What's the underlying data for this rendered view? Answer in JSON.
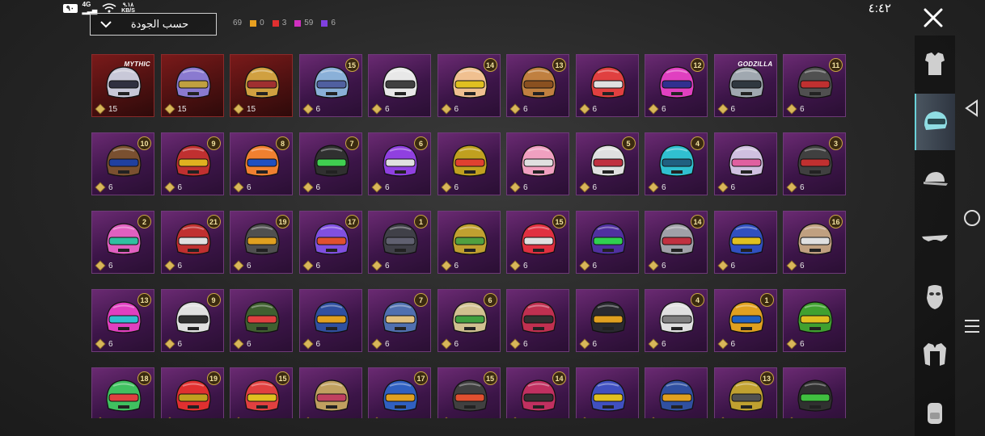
{
  "status": {
    "battery": "٩٠",
    "signal": "4G",
    "speed_value": "٩.١٨",
    "speed_unit": "KB/S",
    "clock": "٤:٤٢"
  },
  "sort": {
    "label": "حسب الجودة"
  },
  "counters": {
    "total": "69",
    "items": [
      {
        "name": "orange",
        "color": "#e8a020",
        "value": "0"
      },
      {
        "name": "red",
        "color": "#e03030",
        "value": "3"
      },
      {
        "name": "pink",
        "color": "#d030c0",
        "value": "59"
      },
      {
        "name": "purple",
        "color": "#8040e0",
        "value": "6"
      }
    ]
  },
  "grid": {
    "rows": [
      [
        {
          "badge": "",
          "tag": "MYTHIC",
          "count": "15",
          "tier": "red",
          "helmet": "#c8c8d8",
          "visor": "#303040"
        },
        {
          "badge": "",
          "tag": "",
          "count": "15",
          "tier": "red",
          "helmet": "#8a7ad0",
          "visor": "#c0a040"
        },
        {
          "badge": "",
          "tag": "",
          "count": "15",
          "tier": "red",
          "helmet": "#d0a040",
          "visor": "#a03030"
        },
        {
          "badge": "15",
          "tag": "",
          "count": "6",
          "tier": "purple",
          "helmet": "#8ab0d8",
          "visor": "#5060a0"
        },
        {
          "badge": "",
          "tag": "",
          "count": "6",
          "tier": "purple",
          "helmet": "#e8e8e8",
          "visor": "#404040"
        },
        {
          "badge": "14",
          "tag": "",
          "count": "6",
          "tier": "purple",
          "helmet": "#f0c090",
          "visor": "#e0c020"
        },
        {
          "badge": "13",
          "tag": "",
          "count": "6",
          "tier": "purple",
          "helmet": "#c08040",
          "visor": "#8a5020"
        },
        {
          "badge": "",
          "tag": "",
          "count": "6",
          "tier": "purple",
          "helmet": "#e04040",
          "visor": "#e0e0e0"
        },
        {
          "badge": "12",
          "tag": "",
          "count": "6",
          "tier": "purple",
          "helmet": "#e040c0",
          "visor": "#303090"
        },
        {
          "badge": "",
          "tag": "GODZILLA",
          "count": "6",
          "tier": "purple",
          "helmet": "#a0a8b0",
          "visor": "#303840"
        },
        {
          "badge": "11",
          "tag": "",
          "count": "6",
          "tier": "purple",
          "helmet": "#505050",
          "visor": "#c03030"
        }
      ],
      [
        {
          "badge": "10",
          "tag": "",
          "count": "6",
          "tier": "purple",
          "helmet": "#7a5030",
          "visor": "#2040a0"
        },
        {
          "badge": "9",
          "tag": "",
          "count": "6",
          "tier": "purple",
          "helmet": "#c03030",
          "visor": "#e0b020"
        },
        {
          "badge": "8",
          "tag": "",
          "count": "6",
          "tier": "purple",
          "helmet": "#f08030",
          "visor": "#2050c0"
        },
        {
          "badge": "7",
          "tag": "",
          "count": "6",
          "tier": "purple",
          "helmet": "#303030",
          "visor": "#40d050"
        },
        {
          "badge": "6",
          "tag": "",
          "count": "6",
          "tier": "purple",
          "helmet": "#9040e0",
          "visor": "#e0e0e0"
        },
        {
          "badge": "",
          "tag": "",
          "count": "6",
          "tier": "purple",
          "helmet": "#c0a020",
          "visor": "#e04030"
        },
        {
          "badge": "",
          "tag": "",
          "count": "6",
          "tier": "purple",
          "helmet": "#f0a0c0",
          "visor": "#e0e0e0"
        },
        {
          "badge": "5",
          "tag": "",
          "count": "6",
          "tier": "purple",
          "helmet": "#e0e0e0",
          "visor": "#c03040"
        },
        {
          "badge": "4",
          "tag": "",
          "count": "6",
          "tier": "purple",
          "helmet": "#30c0d0",
          "visor": "#206080"
        },
        {
          "badge": "",
          "tag": "",
          "count": "6",
          "tier": "purple",
          "helmet": "#d0c0e0",
          "visor": "#e060a0"
        },
        {
          "badge": "3",
          "tag": "",
          "count": "6",
          "tier": "purple",
          "helmet": "#404040",
          "visor": "#c03030"
        }
      ],
      [
        {
          "badge": "2",
          "tag": "",
          "count": "6",
          "tier": "purple",
          "helmet": "#e060c0",
          "visor": "#30c0a0"
        },
        {
          "badge": "21",
          "tag": "",
          "count": "6",
          "tier": "purple",
          "helmet": "#c03030",
          "visor": "#e0e0e0"
        },
        {
          "badge": "19",
          "tag": "",
          "count": "6",
          "tier": "purple",
          "helmet": "#505050",
          "visor": "#e0a020"
        },
        {
          "badge": "17",
          "tag": "",
          "count": "6",
          "tier": "purple",
          "helmet": "#8050e0",
          "visor": "#e05030"
        },
        {
          "badge": "1",
          "tag": "",
          "count": "6",
          "tier": "purple",
          "helmet": "#404048",
          "visor": "#606070"
        },
        {
          "badge": "",
          "tag": "",
          "count": "6",
          "tier": "purple",
          "helmet": "#c0a030",
          "visor": "#50a040"
        },
        {
          "badge": "15",
          "tag": "",
          "count": "6",
          "tier": "purple",
          "helmet": "#e03040",
          "visor": "#e0e0e0"
        },
        {
          "badge": "",
          "tag": "",
          "count": "6",
          "tier": "purple",
          "helmet": "#5030a0",
          "visor": "#30d050"
        },
        {
          "badge": "14",
          "tag": "",
          "count": "6",
          "tier": "purple",
          "helmet": "#a0a0a8",
          "visor": "#c03040"
        },
        {
          "badge": "",
          "tag": "",
          "count": "6",
          "tier": "purple",
          "helmet": "#3050c0",
          "visor": "#e0c020"
        },
        {
          "badge": "16",
          "tag": "",
          "count": "6",
          "tier": "purple",
          "helmet": "#c0a080",
          "visor": "#e0e0e0"
        }
      ],
      [
        {
          "badge": "13",
          "tag": "",
          "count": "6",
          "tier": "purple",
          "helmet": "#e040c0",
          "visor": "#30c0d0"
        },
        {
          "badge": "9",
          "tag": "",
          "count": "6",
          "tier": "purple",
          "helmet": "#e0e0e0",
          "visor": "#303030"
        },
        {
          "badge": "",
          "tag": "",
          "count": "6",
          "tier": "purple",
          "helmet": "#406030",
          "visor": "#e04040"
        },
        {
          "badge": "",
          "tag": "",
          "count": "6",
          "tier": "purple",
          "helmet": "#3050a0",
          "visor": "#e0a020"
        },
        {
          "badge": "7",
          "tag": "",
          "count": "6",
          "tier": "purple",
          "helmet": "#5070b0",
          "visor": "#e0c080"
        },
        {
          "badge": "6",
          "tag": "",
          "count": "6",
          "tier": "purple",
          "helmet": "#d0c090",
          "visor": "#40a040"
        },
        {
          "badge": "",
          "tag": "",
          "count": "6",
          "tier": "purple",
          "helmet": "#c03050",
          "visor": "#303030"
        },
        {
          "badge": "",
          "tag": "",
          "count": "6",
          "tier": "purple",
          "helmet": "#2a2a30",
          "visor": "#e0a020"
        },
        {
          "badge": "4",
          "tag": "",
          "count": "6",
          "tier": "purple",
          "helmet": "#e0e0e0",
          "visor": "#808080"
        },
        {
          "badge": "1",
          "tag": "",
          "count": "6",
          "tier": "purple",
          "helmet": "#e0a020",
          "visor": "#2060c0"
        },
        {
          "badge": "",
          "tag": "",
          "count": "6",
          "tier": "purple",
          "helmet": "#40a030",
          "visor": "#e0c020"
        }
      ],
      [
        {
          "badge": "18",
          "tag": "",
          "count": "6",
          "tier": "purple",
          "helmet": "#40c060",
          "visor": "#e04040"
        },
        {
          "badge": "19",
          "tag": "",
          "count": "6",
          "tier": "purple",
          "helmet": "#e03030",
          "visor": "#c0a020"
        },
        {
          "badge": "15",
          "tag": "",
          "count": "6",
          "tier": "purple",
          "helmet": "#e04040",
          "visor": "#e0c020"
        },
        {
          "badge": "",
          "tag": "",
          "count": "6",
          "tier": "purple",
          "helmet": "#c0a060",
          "visor": "#c04060"
        },
        {
          "badge": "17",
          "tag": "",
          "count": "6",
          "tier": "purple",
          "helmet": "#3060c0",
          "visor": "#e0a020"
        },
        {
          "badge": "15",
          "tag": "",
          "count": "6",
          "tier": "purple",
          "helmet": "#404040",
          "visor": "#e05030"
        },
        {
          "badge": "14",
          "tag": "",
          "count": "6",
          "tier": "purple",
          "helmet": "#c03060",
          "visor": "#303030"
        },
        {
          "badge": "",
          "tag": "",
          "count": "6",
          "tier": "purple",
          "helmet": "#4050c0",
          "visor": "#e0c020"
        },
        {
          "badge": "",
          "tag": "",
          "count": "6",
          "tier": "purple",
          "helmet": "#3050a0",
          "visor": "#e0a020"
        },
        {
          "badge": "13",
          "tag": "",
          "count": "6",
          "tier": "purple",
          "helmet": "#c0a030",
          "visor": "#505050"
        },
        {
          "badge": "",
          "tag": "",
          "count": "6",
          "tier": "purple",
          "helmet": "#303030",
          "visor": "#40c040"
        }
      ]
    ]
  },
  "sidebar": {
    "categories": [
      {
        "name": "outfit",
        "icon": "outfit-icon",
        "active": false
      },
      {
        "name": "helmet",
        "icon": "helmet-icon",
        "active": true
      },
      {
        "name": "cap",
        "icon": "cap-icon",
        "active": false
      },
      {
        "name": "glasses",
        "icon": "glasses-icon",
        "active": false
      },
      {
        "name": "mask",
        "icon": "mask-icon",
        "active": false
      },
      {
        "name": "jacket",
        "icon": "jacket-icon",
        "active": false
      },
      {
        "name": "backpack",
        "icon": "backpack-icon",
        "active": false
      }
    ]
  },
  "nav": {
    "back": "back-icon",
    "home": "home-icon",
    "menu": "menu-icon"
  }
}
